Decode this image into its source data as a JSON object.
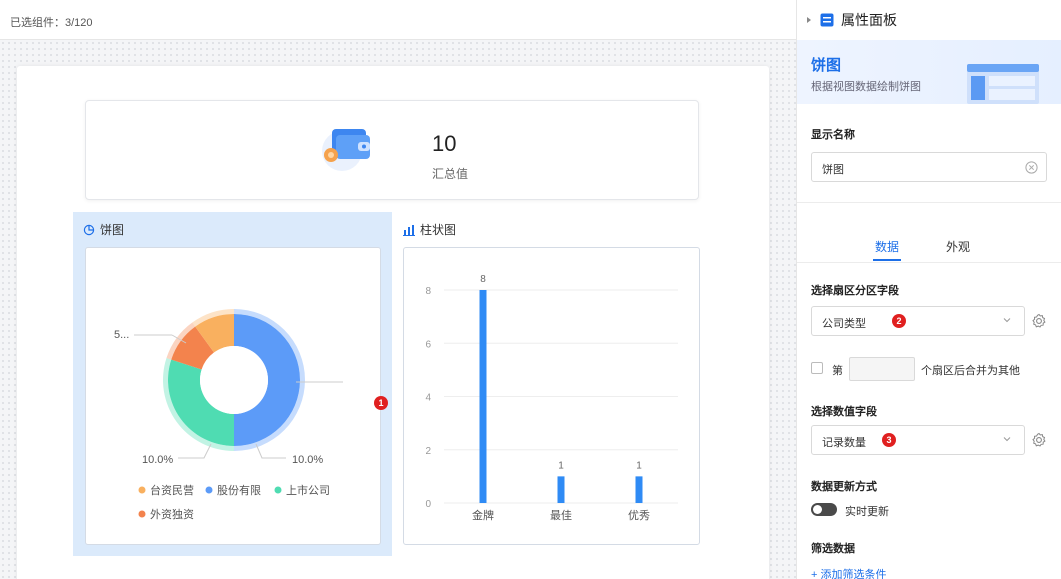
{
  "topbar": {
    "selected_count": "已选组件：3/120"
  },
  "summary": {
    "value": "10",
    "label": "汇总值"
  },
  "pie_widget": {
    "title": "饼图",
    "labels": {
      "left_top": "5...",
      "bottom_left": "10.0%",
      "bottom_right": "10.0%"
    },
    "legend": [
      {
        "name": "台资民营",
        "color": "#f9b05f"
      },
      {
        "name": "股份有限",
        "color": "#5c9bf8"
      },
      {
        "name": "上市公司",
        "color": "#4fdcb2"
      },
      {
        "name": "外资独资",
        "color": "#f3834d"
      }
    ]
  },
  "bar_widget": {
    "title": "柱状图"
  },
  "chart_data": [
    {
      "type": "pie",
      "categories": [
        "股份有限",
        "上市公司",
        "外资独资",
        "台资民营"
      ],
      "values": [
        5,
        3,
        1,
        1
      ],
      "colors": [
        "#5c9bf8",
        "#4fdcb2",
        "#f3834d",
        "#f9b05f"
      ],
      "donut": true
    },
    {
      "type": "bar",
      "categories": [
        "金牌",
        "最佳",
        "优秀"
      ],
      "values": [
        8,
        1,
        1
      ],
      "ylim": [
        0,
        8
      ],
      "yticks": [
        0,
        2,
        4,
        6,
        8
      ],
      "color": "#2f8bf5"
    }
  ],
  "badges": {
    "b1": "1",
    "b2": "2",
    "b3": "3"
  },
  "panel": {
    "title": "属性面板",
    "hero_title": "饼图",
    "hero_sub": "根据视图数据绘制饼图",
    "display_name_label": "显示名称",
    "display_name_value": "饼图",
    "tabs": [
      "数据",
      "外观"
    ],
    "sector_field_label": "选择扇区分区字段",
    "sector_field_value": "公司类型",
    "merge_prefix": "第",
    "merge_suffix": "个扇区后合并为其他",
    "value_field_label": "选择数值字段",
    "value_field_value": "记录数量",
    "update_label": "数据更新方式",
    "update_value": "实时更新",
    "filter_label": "筛选数据",
    "add_filter": "+ 添加筛选条件"
  },
  "colors": {
    "accent": "#1d6fe8",
    "selected_bg": "#dbeafb",
    "badge": "#e02020"
  }
}
